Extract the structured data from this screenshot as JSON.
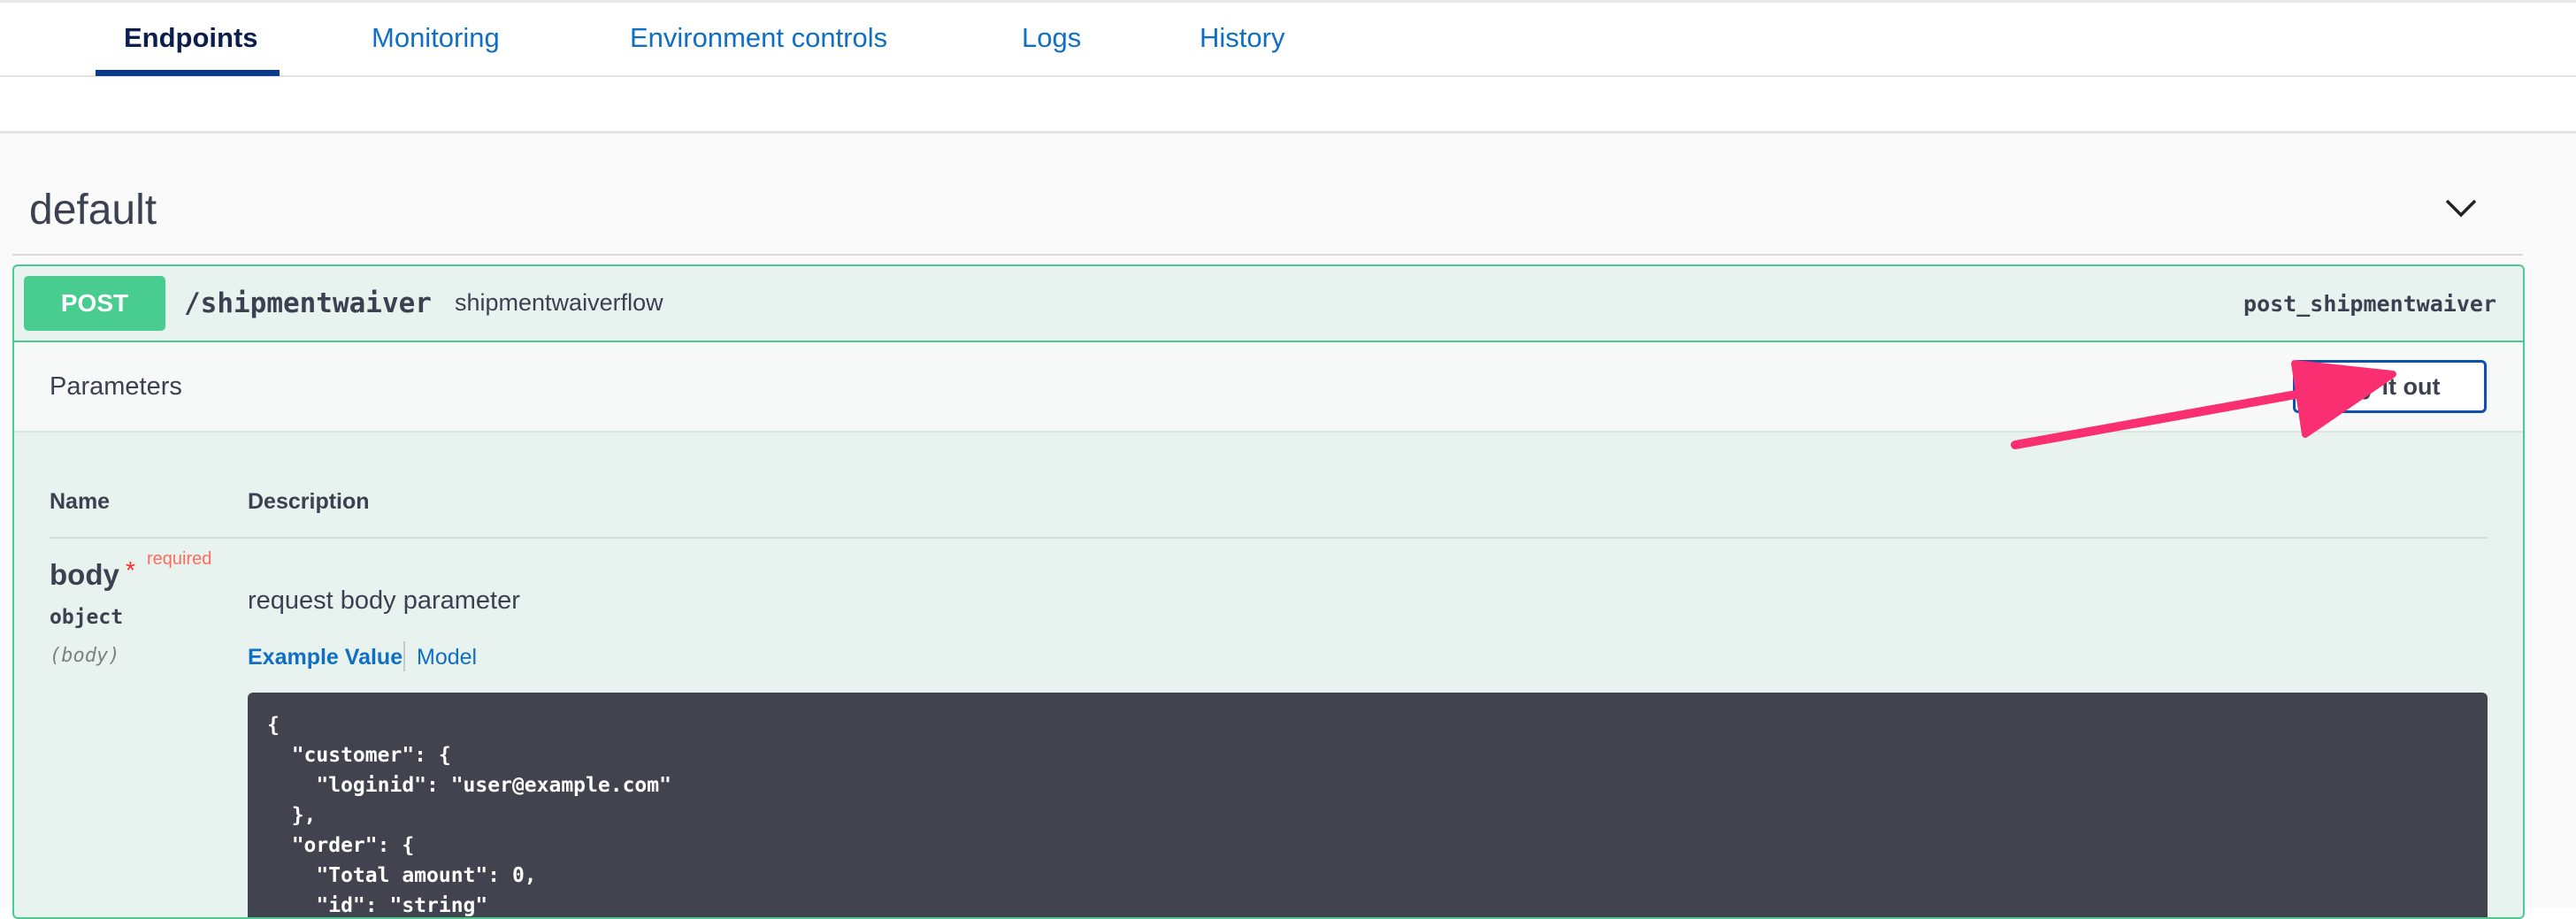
{
  "tabs": [
    {
      "label": "Endpoints"
    },
    {
      "label": "Monitoring"
    },
    {
      "label": "Environment controls"
    },
    {
      "label": "Logs"
    },
    {
      "label": "History"
    }
  ],
  "section": {
    "title": "default",
    "collapse_icon": "chevron-down-icon"
  },
  "operation": {
    "method": "POST",
    "path": "/shipmentwaiver",
    "description": "shipmentwaiverflow",
    "operation_id": "post_shipmentwaiver",
    "method_color": "#49cc90"
  },
  "parameters": {
    "title": "Parameters",
    "try_button": "Try it out",
    "columns": {
      "name": "Name",
      "description": "Description"
    },
    "items": [
      {
        "name": "body",
        "required_marker": "*",
        "required_label": "required",
        "type": "object",
        "in": "(body)",
        "description": "request body parameter",
        "tabs": {
          "example": "Example Value",
          "model": "Model"
        },
        "example": "{\n  \"customer\": {\n    \"loginid\": \"user@example.com\"\n  },\n  \"order\": {\n    \"Total amount\": 0,\n    \"id\": \"string\""
      }
    ]
  },
  "annotation": {
    "icon": "arrow-icon",
    "color": "#f92f72"
  }
}
